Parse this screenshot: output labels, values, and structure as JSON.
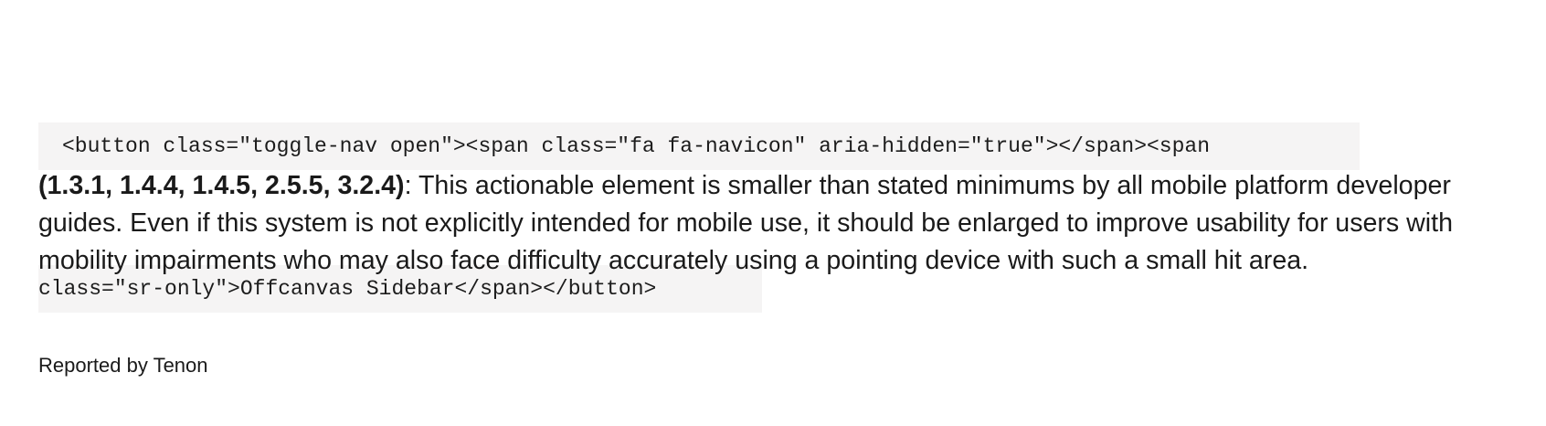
{
  "code": {
    "line1": "<button class=\"toggle-nav open\"><span class=\"fa fa-navicon\" aria-hidden=\"true\"></span><span",
    "line2": "class=\"sr-only\">Offcanvas Sidebar</span></button>"
  },
  "issue": {
    "criteria": "(1.3.1, 1.4.4, 1.4.5, 2.5.5, 3.2.4)",
    "description": ": This actionable element is smaller than stated minimums by all mobile platform developer guides. Even if this system is not explicitly intended for mobile use, it should be enlarged to improve usability for users with mobility impairments who may also face difficulty accurately using a pointing device with such a small hit area."
  },
  "reporter": {
    "label": "Reported by Tenon"
  }
}
